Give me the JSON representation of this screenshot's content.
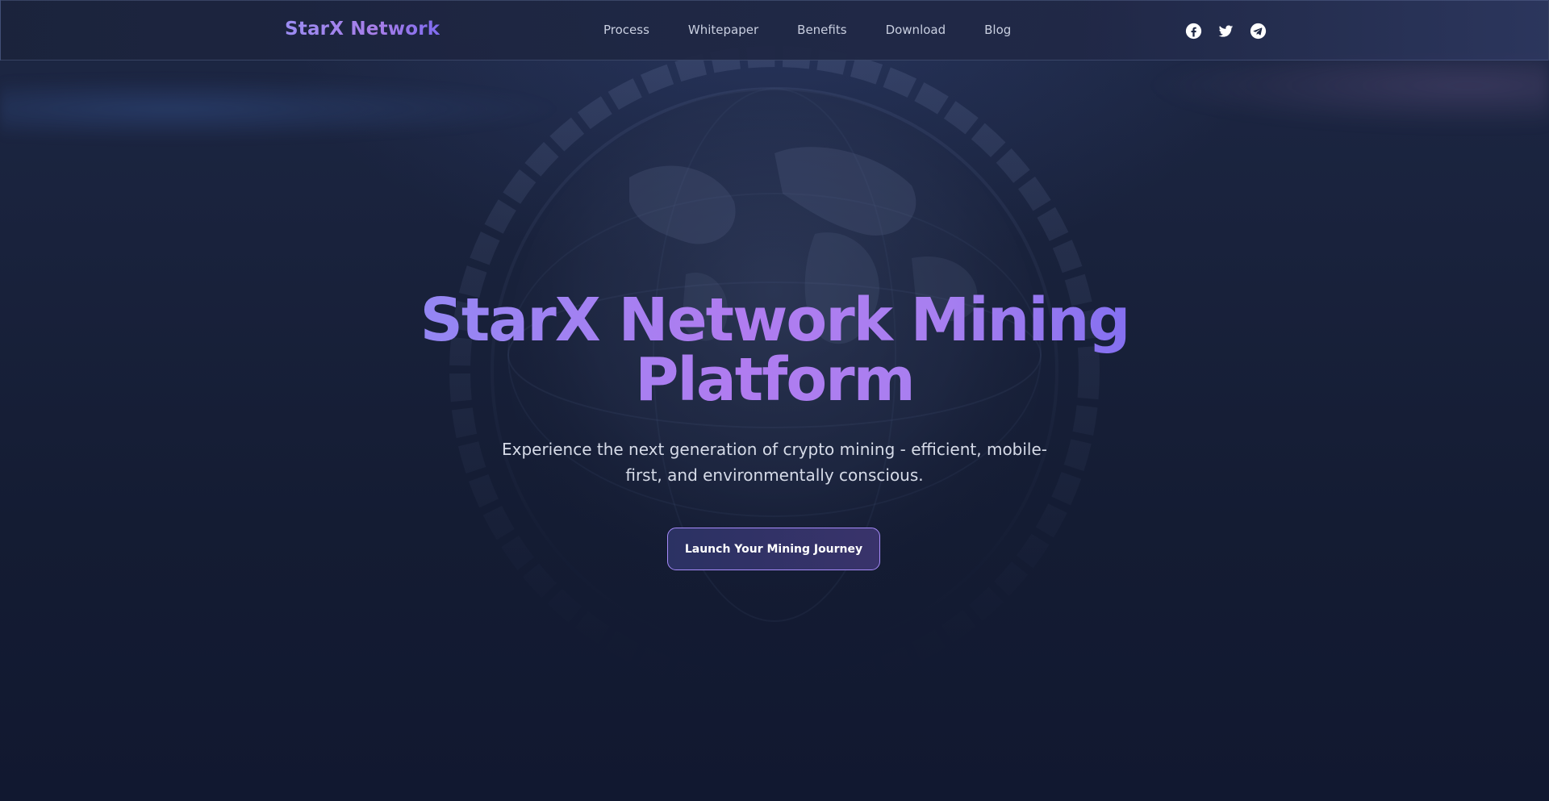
{
  "header": {
    "brand": "StarX Network",
    "nav": [
      "Process",
      "Whitepaper",
      "Benefits",
      "Download",
      "Blog"
    ],
    "socials": [
      "facebook-icon",
      "twitter-icon",
      "telegram-icon"
    ]
  },
  "hero": {
    "title_line1": "StarX Network Mining",
    "title_line2": "Platform",
    "subtitle_line1": "Experience the next generation of crypto mining - efficient, mobile-",
    "subtitle_line2": "first, and environmentally conscious.",
    "cta_label": "Launch Your Mining Journey"
  },
  "colors": {
    "background": "#121a30",
    "accent_purple": "#a78bfa",
    "nav_text": "#c9cfe0"
  }
}
